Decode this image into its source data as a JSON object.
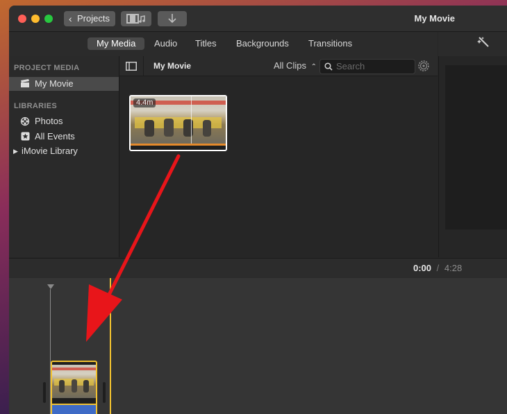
{
  "titlebar": {
    "back_label": "Projects",
    "title": "My Movie",
    "media_icon": "film-music-icon",
    "import_icon": "download-arrow-icon"
  },
  "tabs": [
    {
      "label": "My Media",
      "active": true
    },
    {
      "label": "Audio",
      "active": false
    },
    {
      "label": "Titles",
      "active": false
    },
    {
      "label": "Backgrounds",
      "active": false
    },
    {
      "label": "Transitions",
      "active": false
    }
  ],
  "sidebar": {
    "project_media_heading": "PROJECT MEDIA",
    "project_item": "My Movie",
    "libraries_heading": "LIBRARIES",
    "library_items": [
      {
        "label": "Photos",
        "icon": "photos-icon"
      },
      {
        "label": "All Events",
        "icon": "star-icon"
      },
      {
        "label": "iMovie Library",
        "icon": "disclosure-triangle-icon"
      }
    ]
  },
  "browser": {
    "title": "My Movie",
    "filter": "All Clips",
    "search_placeholder": "Search",
    "clip_duration": "4.4m"
  },
  "timeline": {
    "current_time": "0:00",
    "separator": "/",
    "total_time": "4:28"
  },
  "colors": {
    "accent_yellow": "#f2c230",
    "arrow_red": "#e8151a",
    "clip_audio_blue": "#3e6bc6",
    "clip_progress_orange": "#e58a2c"
  }
}
